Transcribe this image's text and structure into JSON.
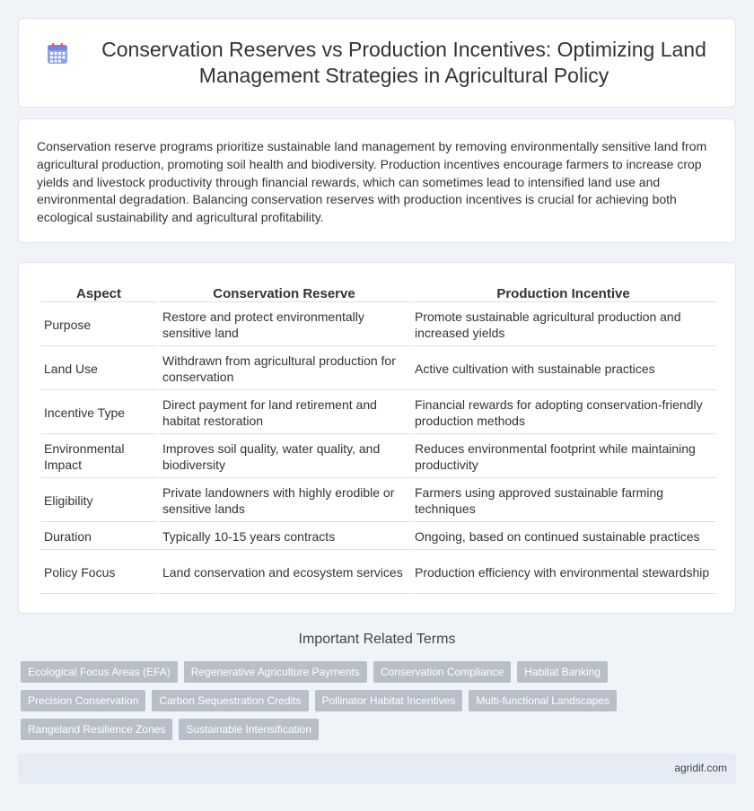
{
  "header": {
    "title": "Conservation Reserves vs Production Incentives: Optimizing Land Management Strategies in Agricultural Policy",
    "icon": "calendar-icon",
    "icon_color": "#7b8fe6"
  },
  "summary": {
    "text": "Conservation reserve programs prioritize sustainable land management by removing environmentally sensitive land from agricultural production, promoting soil health and biodiversity. Production incentives encourage farmers to increase crop yields and livestock productivity through financial rewards, which can sometimes lead to intensified land use and environmental degradation. Balancing conservation reserves with production incentives is crucial for achieving both ecological sustainability and agricultural profitability."
  },
  "table": {
    "headers": [
      "Aspect",
      "Conservation Reserve",
      "Production Incentive"
    ],
    "rows": [
      [
        "Purpose",
        "Restore and protect environmentally sensitive land",
        "Promote sustainable agricultural production and increased yields"
      ],
      [
        "Land Use",
        "Withdrawn from agricultural production for conservation",
        "Active cultivation with sustainable practices"
      ],
      [
        "Incentive Type",
        "Direct payment for land retirement and habitat restoration",
        "Financial rewards for adopting conservation-friendly production methods"
      ],
      [
        "Environmental Impact",
        "Improves soil quality, water quality, and biodiversity",
        "Reduces environmental footprint while maintaining productivity"
      ],
      [
        "Eligibility",
        "Private landowners with highly erodible or sensitive lands",
        "Farmers using approved sustainable farming techniques"
      ],
      [
        "Duration",
        "Typically 10-15 years contracts",
        "Ongoing, based on continued sustainable practices"
      ],
      [
        "Policy Focus",
        "Land conservation and ecosystem services",
        "Production efficiency with environmental stewardship"
      ]
    ]
  },
  "related": {
    "title": "Important Related Terms",
    "tags": [
      "Ecological Focus Areas (EFA)",
      "Regenerative Agriculture Payments",
      "Conservation Compliance",
      "Habitat Banking",
      "Precision Conservation",
      "Carbon Sequestration Credits",
      "Pollinator Habitat Incentives",
      "Multi-functional Landscapes",
      "Rangeland Resilience Zones",
      "Sustainable Intensification"
    ]
  },
  "footer": {
    "site": "agridif.com"
  }
}
